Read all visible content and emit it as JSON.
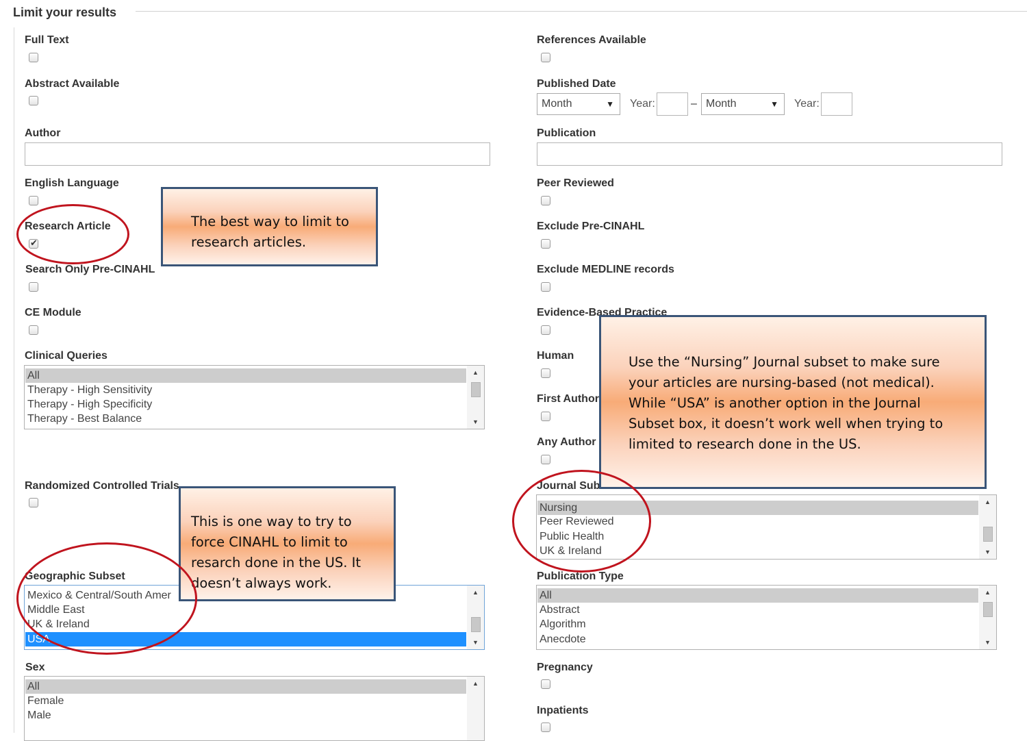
{
  "legend": "Limit your results",
  "left_fields": {
    "full_text": "Full Text",
    "abstract_available": "Abstract Available",
    "author": "Author",
    "english_language": "English Language",
    "research_article": "Research Article",
    "search_only_pre_cinahl": "Search Only Pre-CINAHL",
    "ce_module": "CE Module",
    "clinical_queries": {
      "label": "Clinical Queries",
      "options": [
        "All",
        "Therapy - High Sensitivity",
        "Therapy - High Specificity",
        "Therapy - Best Balance"
      ]
    },
    "randomized_controlled_trials": "Randomized Controlled Trials",
    "geographic_subset": {
      "label": "Geographic Subset",
      "options": [
        "Mexico & Central/South Amer",
        "Middle East",
        "UK & Ireland",
        "USA"
      ]
    },
    "sex": {
      "label": "Sex",
      "options": [
        "All",
        "Female",
        "Male"
      ]
    }
  },
  "right_fields": {
    "references_available": "References Available",
    "published_date": {
      "label": "Published Date",
      "month1": "Month",
      "year1_label": "Year:",
      "dash": "–",
      "month2": "Month",
      "year2_label": "Year:"
    },
    "publication": "Publication",
    "peer_reviewed": "Peer Reviewed",
    "exclude_pre_cinahl": "Exclude Pre-CINAHL",
    "exclude_medline": "Exclude MEDLINE records",
    "evidence_based_practice": "Evidence-Based Practice",
    "human": "Human",
    "first_author": "First Author",
    "any_author": "Any Author",
    "journal_subset": {
      "label": "Journal Subset",
      "options": [
        "Nursing",
        "Peer Reviewed",
        "Public Health",
        "UK & Ireland"
      ]
    },
    "publication_type": {
      "label": "Publication Type",
      "options": [
        "All",
        "Abstract",
        "Algorithm",
        "Anecdote"
      ]
    },
    "pregnancy": "Pregnancy",
    "inpatients": "Inpatients"
  },
  "callouts": {
    "research": [
      "The best way to limit to",
      "research articles."
    ],
    "journal": [
      "Use the “Nursing” Journal subset to make sure",
      "your articles are nursing-based (not medical).",
      "While “USA” is another option in the Journal",
      "Subset box, it doesn’t work well when trying to",
      "limited to research done in the US."
    ],
    "geographic": [
      "This is one way to try to",
      "force CINAHL to limit to",
      "resarch done in the US.  It",
      "doesn’t always work."
    ]
  },
  "colors": {
    "annotation_red": "#c0141e",
    "callout_border": "#3a5578",
    "selected_blue": "#1e90ff"
  }
}
